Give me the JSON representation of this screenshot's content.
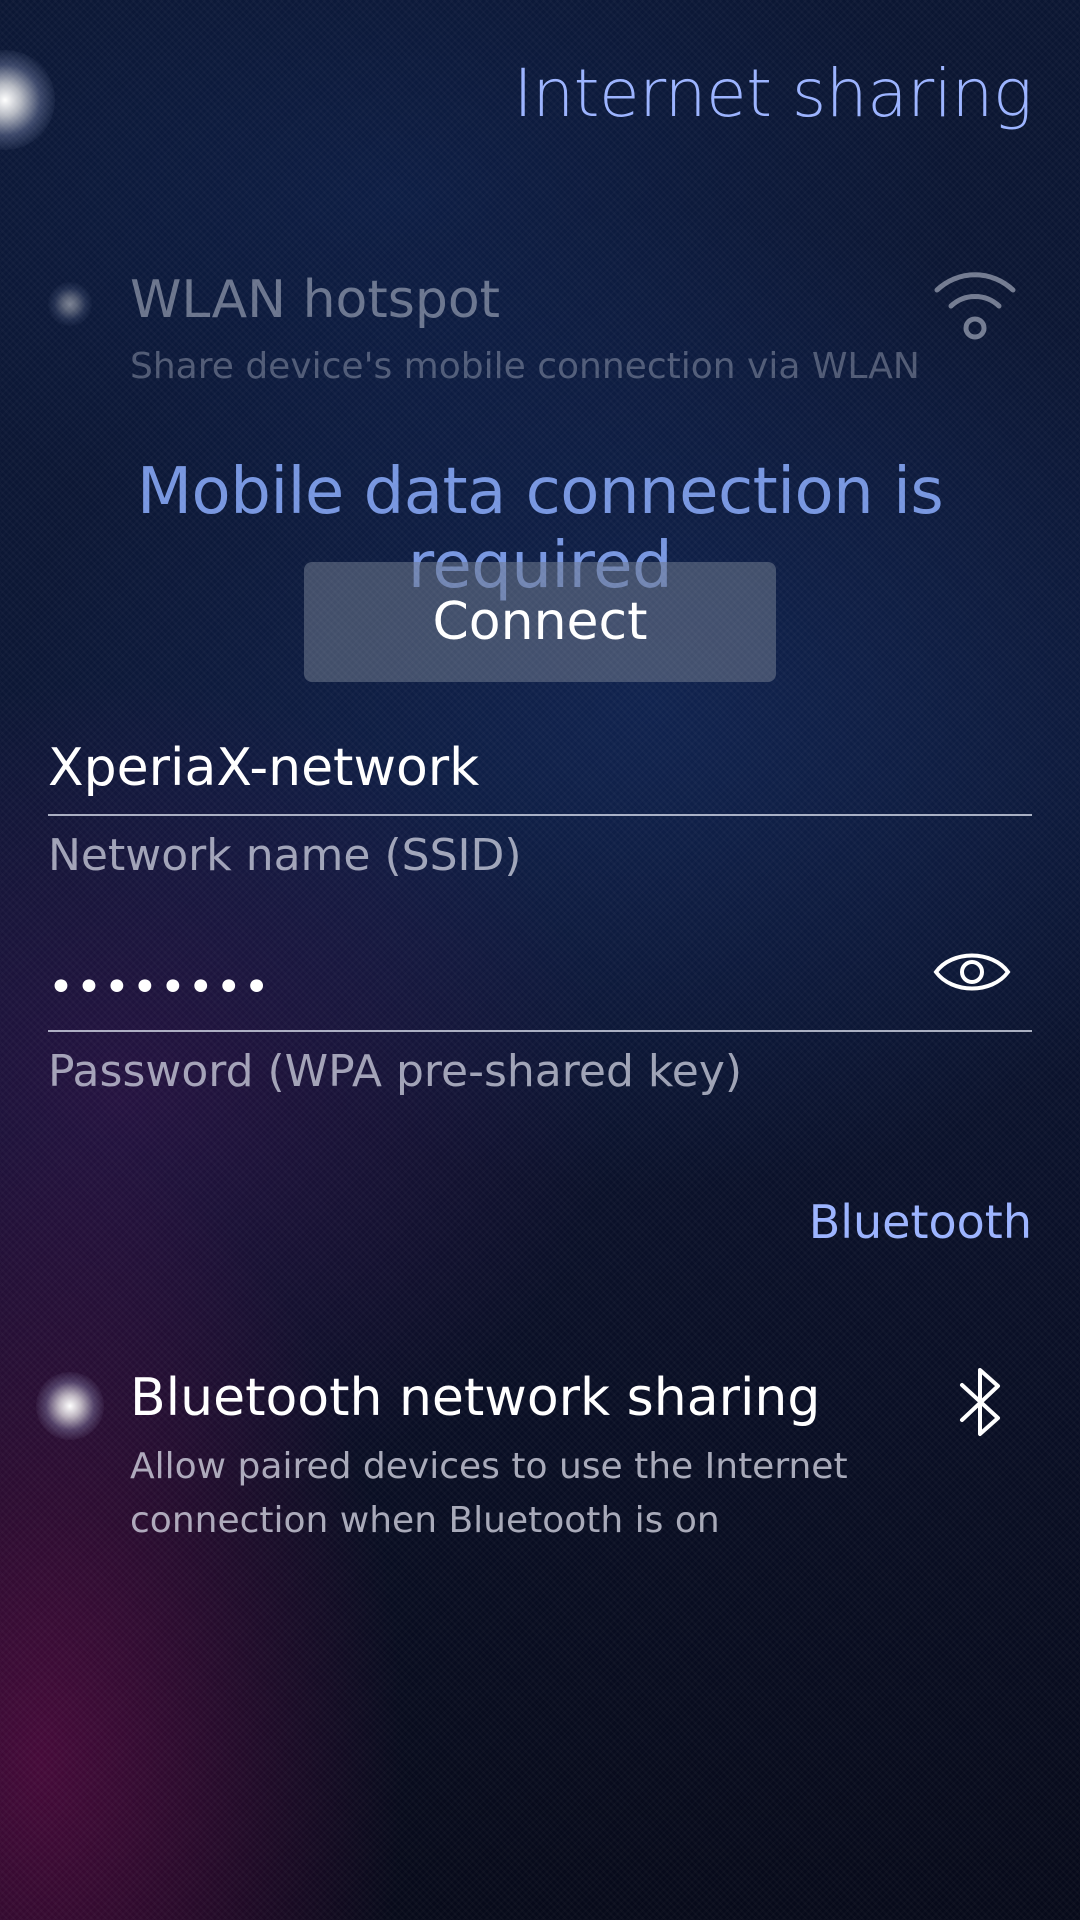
{
  "header": {
    "title": "Internet sharing"
  },
  "wlan": {
    "title": "WLAN hotspot",
    "description": "Share device's mobile connection via WLAN",
    "icon": "wifi-icon",
    "enabled": false
  },
  "mobile_data": {
    "warning": "Mobile data connection is required",
    "connect_label": "Connect"
  },
  "ssid_field": {
    "value": "XperiaX-network",
    "label": "Network name (SSID)"
  },
  "password_field": {
    "value": "••••••••",
    "label": "Password (WPA pre-shared key)",
    "icon": "eye-icon"
  },
  "bluetooth_section": {
    "header": "Bluetooth"
  },
  "bluetooth": {
    "title": "Bluetooth network sharing",
    "description": "Allow paired devices to use the Internet connection when Bluetooth is on",
    "icon": "bluetooth-icon",
    "enabled": true
  },
  "colors": {
    "accent": "#9bb3ff",
    "warning": "#7796e0",
    "text": "#ffffff"
  }
}
